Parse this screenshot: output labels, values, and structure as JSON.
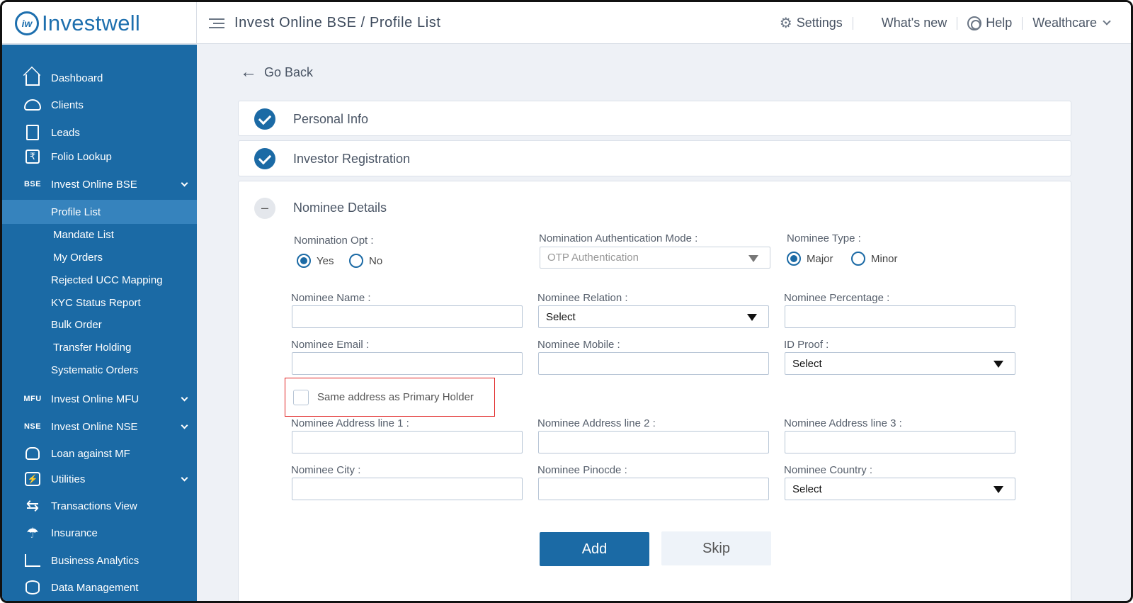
{
  "brand": {
    "logo_mark": "iw",
    "name": "Investwell"
  },
  "header": {
    "breadcrumb": "Invest Online BSE / Profile List",
    "settings": "Settings",
    "whats_new": "What's new",
    "help": "Help",
    "account": "Wealthcare"
  },
  "sidebar": {
    "items": [
      {
        "label": "Dashboard",
        "icon": "home-icon"
      },
      {
        "label": "Clients",
        "icon": "users-icon"
      },
      {
        "label": "Leads",
        "icon": "leads-icon"
      },
      {
        "label": "Folio Lookup",
        "icon": "folio-icon"
      },
      {
        "label": "Invest Online BSE",
        "icon_text": "BSE"
      },
      {
        "label": "Profile List"
      },
      {
        "label": "Mandate List"
      },
      {
        "label": "My Orders"
      },
      {
        "label": "Rejected UCC Mapping"
      },
      {
        "label": "KYC Status Report"
      },
      {
        "label": "Bulk Order"
      },
      {
        "label": "Transfer Holding"
      },
      {
        "label": "Systematic Orders"
      },
      {
        "label": "Invest Online MFU",
        "icon_text": "MFU"
      },
      {
        "label": "Invest Online NSE",
        "icon_text": "NSE"
      },
      {
        "label": "Loan against MF",
        "icon": "money-bag-icon"
      },
      {
        "label": "Utilities",
        "icon": "bolt-icon"
      },
      {
        "label": "Transactions View",
        "icon": "transfer-arrows-icon"
      },
      {
        "label": "Insurance",
        "icon": "umbrella-icon"
      },
      {
        "label": "Business Analytics",
        "icon": "analytics-icon"
      },
      {
        "label": "Data Management",
        "icon": "database-icon"
      }
    ]
  },
  "main": {
    "go_back": "Go Back",
    "sections": {
      "personal_info": "Personal Info",
      "investor_registration": "Investor Registration",
      "nominee_details": "Nominee Details"
    },
    "form": {
      "nomination_opt": {
        "label": "Nomination Opt :",
        "yes": "Yes",
        "no": "No",
        "selected": "Yes"
      },
      "auth_mode": {
        "label": "Nomination Authentication Mode :",
        "value": "OTP Authentication"
      },
      "nominee_type": {
        "label": "Nominee Type :",
        "major": "Major",
        "minor": "Minor",
        "selected": "Major"
      },
      "name": {
        "label": "Nominee Name :",
        "value": ""
      },
      "relation": {
        "label": "Nominee Relation :",
        "value": "Select"
      },
      "percentage": {
        "label": "Nominee Percentage :",
        "value": ""
      },
      "email": {
        "label": "Nominee Email :",
        "value": ""
      },
      "mobile": {
        "label": "Nominee Mobile :",
        "value": ""
      },
      "id_proof": {
        "label": "ID Proof :",
        "value": "Select"
      },
      "same_address": {
        "label": "Same address as Primary Holder",
        "checked": false
      },
      "address1": {
        "label": "Nominee Address line 1 :",
        "value": ""
      },
      "address2": {
        "label": "Nominee Address line 2 :",
        "value": ""
      },
      "address3": {
        "label": "Nominee Address line 3 :",
        "value": ""
      },
      "city": {
        "label": "Nominee City :",
        "value": ""
      },
      "pincode": {
        "label": "Nominee Pinocde :",
        "value": ""
      },
      "country": {
        "label": "Nominee Country :",
        "value": "Select"
      }
    },
    "buttons": {
      "add": "Add",
      "skip": "Skip"
    }
  },
  "colors": {
    "primary": "#1b6aa5",
    "active_nav": "#3683bd",
    "highlight": "#e02020"
  }
}
